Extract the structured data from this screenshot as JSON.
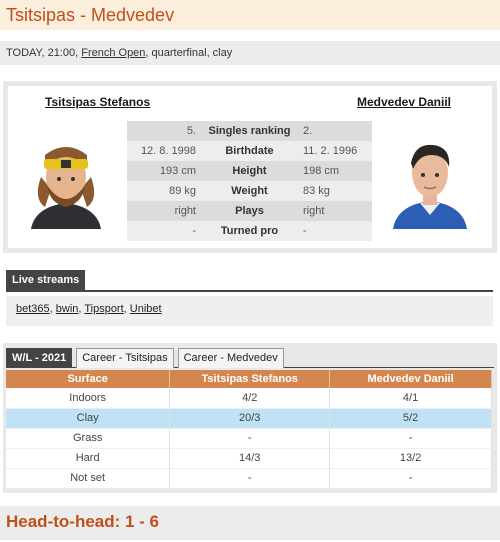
{
  "header": {
    "title": "Tsitsipas - Medvedev"
  },
  "match_info": {
    "prefix": "TODAY, 21:00, ",
    "tournament": "French Open",
    "suffix": ", quarterfinal, clay"
  },
  "players": {
    "left_name": "Tsitsipas Stefanos",
    "right_name": "Medvedev Daniil"
  },
  "stats": [
    {
      "left": "5.",
      "label": "Singles ranking",
      "right": "2."
    },
    {
      "left": "12. 8. 1998",
      "label": "Birthdate",
      "right": "11. 2. 1996"
    },
    {
      "left": "193 cm",
      "label": "Height",
      "right": "198 cm"
    },
    {
      "left": "89 kg",
      "label": "Weight",
      "right": "83 kg"
    },
    {
      "left": "right",
      "label": "Plays",
      "right": "right"
    },
    {
      "left": "-",
      "label": "Turned pro",
      "right": "-"
    }
  ],
  "streams": {
    "header": "Live streams",
    "links": [
      "bet365",
      "bwin",
      "Tipsport",
      "Unibet"
    ],
    "separator": ", "
  },
  "wl": {
    "tabs": [
      "W/L - 2021",
      "Career - Tsitsipas",
      "Career - Medvedev"
    ],
    "columns": [
      "Surface",
      "Tsitsipas Stefanos",
      "Medvedev Daniil"
    ],
    "rows": [
      [
        "Indoors",
        "4/2",
        "4/1"
      ],
      [
        "Clay",
        "20/3",
        "5/2"
      ],
      [
        "Grass",
        "-",
        "-"
      ],
      [
        "Hard",
        "14/3",
        "13/2"
      ],
      [
        "Not set",
        "-",
        "-"
      ]
    ]
  },
  "h2h": {
    "text": "Head-to-head: 1 - 6"
  },
  "colors": {
    "accent": "#c0501b",
    "table_header": "#d4864f",
    "highlight_row": "#bfe3f5"
  }
}
